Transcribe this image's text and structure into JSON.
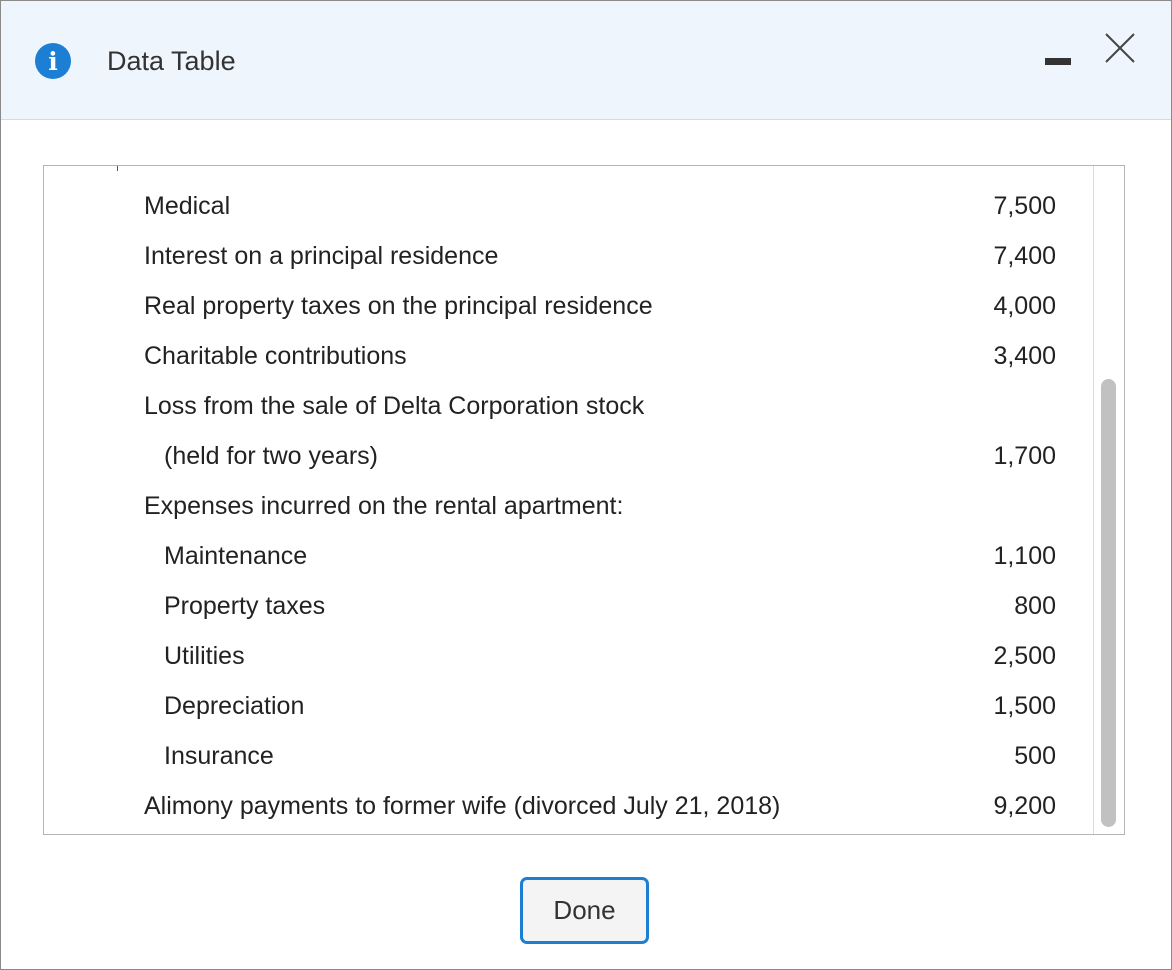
{
  "dialog": {
    "title": "Data Table",
    "icons": {
      "info": "info-icon",
      "minimize": "minimize-icon",
      "close": "close-icon"
    },
    "colors": {
      "header_bg": "#eef5fc",
      "accent": "#1c7fd4"
    }
  },
  "table": {
    "rows": [
      {
        "label": "Medical",
        "value": "7,500",
        "indent": 0
      },
      {
        "label": "Interest on a principal residence",
        "value": "7,400",
        "indent": 0
      },
      {
        "label": "Real property taxes on the principal residence",
        "value": "4,000",
        "indent": 0
      },
      {
        "label": "Charitable contributions",
        "value": "3,400",
        "indent": 0
      },
      {
        "label": "Loss from the sale of Delta Corporation stock",
        "value": "",
        "indent": 0
      },
      {
        "label": "(held for two years)",
        "value": "1,700",
        "indent": 1
      },
      {
        "label": "Expenses incurred on the rental apartment:",
        "value": "",
        "indent": 0
      },
      {
        "label": "Maintenance",
        "value": "1,100",
        "indent": 1
      },
      {
        "label": "Property taxes",
        "value": "800",
        "indent": 1
      },
      {
        "label": "Utilities",
        "value": "2,500",
        "indent": 1
      },
      {
        "label": "Depreciation",
        "value": "1,500",
        "indent": 1
      },
      {
        "label": "Insurance",
        "value": "500",
        "indent": 1
      },
      {
        "label": "Alimony payments to former wife (divorced July 21, 2018)",
        "value": "9,200",
        "indent": 0
      }
    ]
  },
  "footer": {
    "done_label": "Done"
  }
}
